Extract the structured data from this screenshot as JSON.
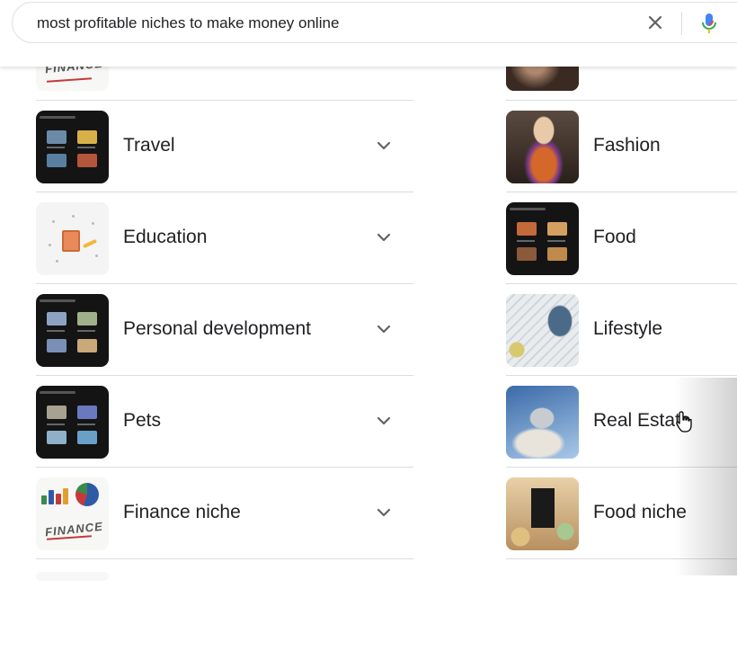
{
  "search": {
    "query": "most profitable niches to make money online",
    "clear_icon": "close-icon",
    "mic_icon": "microphone-icon"
  },
  "left_column": {
    "items": [
      {
        "label": "Travel",
        "thumb": "video-grid"
      },
      {
        "label": "Education",
        "thumb": "education-illustration"
      },
      {
        "label": "Personal development",
        "thumb": "video-grid"
      },
      {
        "label": "Pets",
        "thumb": "video-grid"
      },
      {
        "label": "Finance niche",
        "thumb": "finance-illustration"
      }
    ],
    "expand_icon": "chevron-down-icon"
  },
  "right_column": {
    "items": [
      {
        "label": "Fashion",
        "thumb": "fashion-photo"
      },
      {
        "label": "Food",
        "thumb": "video-grid"
      },
      {
        "label": "Lifestyle",
        "thumb": "lifestyle-photo"
      },
      {
        "label": "Real Estate",
        "thumb": "real-estate-photo"
      },
      {
        "label": "Food niche",
        "thumb": "food-phone-photo"
      }
    ]
  },
  "colors": {
    "text": "#202124",
    "divider": "#dadce0",
    "mic_blue": "#4285f4",
    "mic_red": "#ea4335"
  }
}
